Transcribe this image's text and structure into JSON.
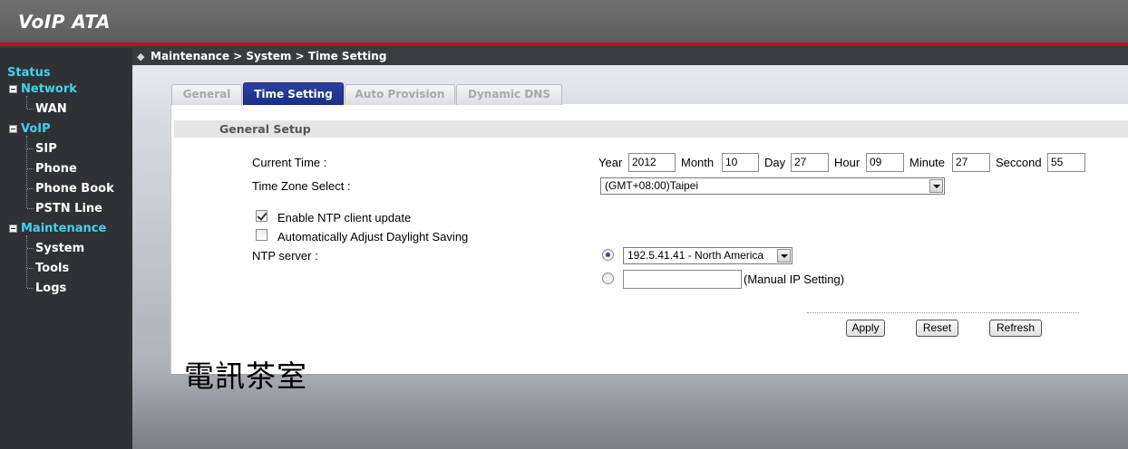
{
  "app": {
    "title": "VoIP ATA"
  },
  "breadcrumb": "Maintenance > System > Time Setting",
  "sidebar": {
    "status": "Status",
    "network": {
      "label": "Network",
      "items": [
        "WAN"
      ]
    },
    "voip": {
      "label": "VoIP",
      "items": [
        "SIP",
        "Phone",
        "Phone Book",
        "PSTN Line"
      ]
    },
    "maintenance": {
      "label": "Maintenance",
      "items": [
        "System",
        "Tools",
        "Logs"
      ]
    }
  },
  "tabs": [
    {
      "label": "General",
      "active": false
    },
    {
      "label": "Time Setting",
      "active": true
    },
    {
      "label": "Auto Provision",
      "active": false
    },
    {
      "label": "Dynamic DNS",
      "active": false
    }
  ],
  "section": {
    "title": "General Setup"
  },
  "form": {
    "current_time": {
      "label": "Current Time :",
      "year_label": "Year",
      "year": "2012",
      "month_label": "Month",
      "month": "10",
      "day_label": "Day",
      "day": "27",
      "hour_label": "Hour",
      "hour": "09",
      "minute_label": "Minute",
      "minute": "27",
      "second_label": "Seccond",
      "second": "55"
    },
    "time_zone": {
      "label": "Time Zone Select :",
      "value": "(GMT+08:00)Taipei"
    },
    "ntp_enable": {
      "label": "Enable NTP client update",
      "checked": true
    },
    "daylight": {
      "label": "Automatically Adjust Daylight Saving",
      "checked": false
    },
    "ntp_server": {
      "label": "NTP server :",
      "preset_value": "192.5.41.41 - North America",
      "manual_value": "",
      "manual_hint": "(Manual IP Setting)"
    }
  },
  "buttons": {
    "apply": "Apply",
    "reset": "Reset",
    "refresh": "Refresh"
  },
  "watermark": "電訊茶室",
  "colors": {
    "header_red": "#b3141e",
    "nav_category": "#3fd3f0",
    "active_tab": "#1b2f85",
    "sidebar": "#2f3135"
  }
}
